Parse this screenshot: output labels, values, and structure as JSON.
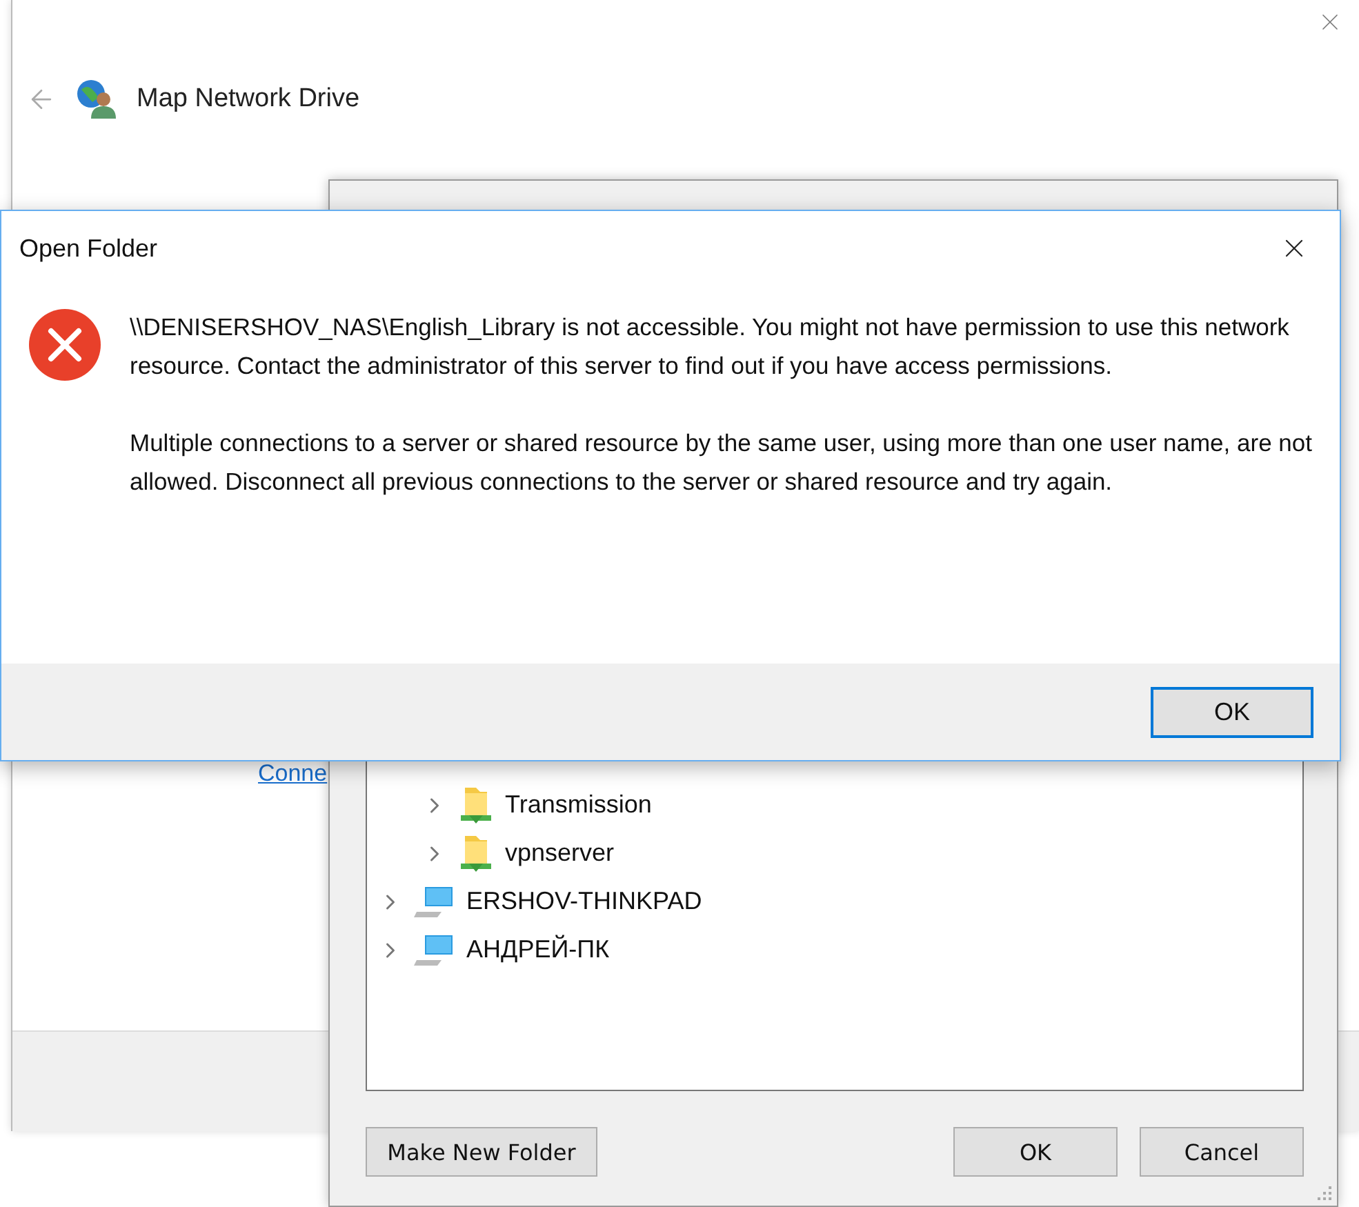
{
  "map_window": {
    "title": "Map Network Drive",
    "link": "Conne"
  },
  "browse_dialog": {
    "tree": [
      {
        "children": [
          {
            "label": "Transmission",
            "kind": "share",
            "expanded": false
          },
          {
            "label": "vpnserver",
            "kind": "share",
            "expanded": false
          }
        ]
      },
      {
        "label": "ERSHOV-THINKPAD",
        "kind": "computer",
        "expanded": false
      },
      {
        "label": "АНДРЕЙ-ПК",
        "kind": "computer",
        "expanded": false
      }
    ],
    "buttons": [
      {
        "label": "Make New Folder",
        "kind": "left"
      },
      {
        "label": "OK",
        "kind": "right"
      },
      {
        "label": "Cancel",
        "kind": "right"
      }
    ]
  },
  "error_dialog": {
    "title": "Open Folder",
    "paragraphs": [
      "\\\\DENISERSHOV_NAS\\English_Library is not accessible. You might not have permission to use this network resource. Contact the administrator of this server to find out if you have access permissions.",
      "Multiple connections to a server or shared resource by the same user, using more than one user name, are not allowed. Disconnect all previous connections to the server or shared resource and try again."
    ],
    "button": "OK"
  }
}
